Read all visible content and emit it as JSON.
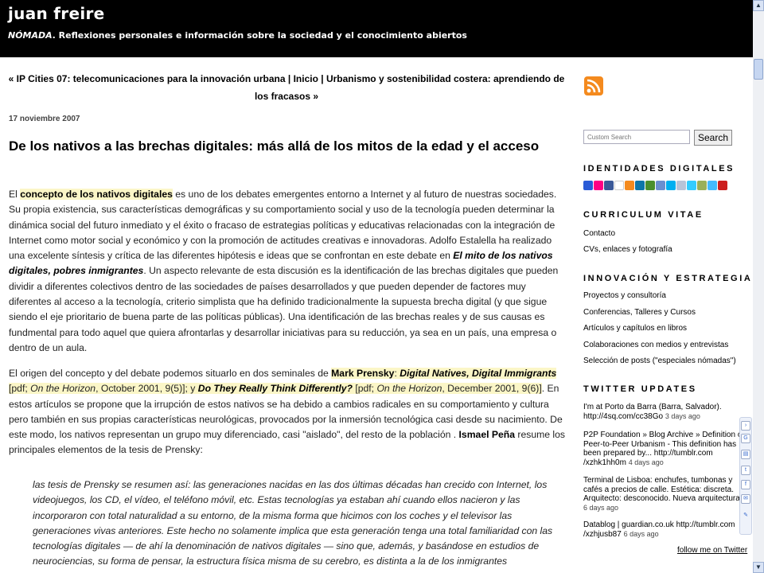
{
  "site": {
    "title": "juan freire",
    "tagline_prefix": "NÓMADA",
    "tagline_rest": ". Reflexiones personales e información sobre la sociedad y el conocimiento abiertos"
  },
  "nav": {
    "prev_label": "« IP Cities 07: telecomunicaciones para la innovación urbana",
    "sep1": " | ",
    "home_label": "Inicio",
    "sep2": " | ",
    "next_label": "Urbanismo y sostenibilidad costera: aprendiendo de los fracasos »"
  },
  "post": {
    "date": "17 noviembre 2007",
    "title": "De los nativos a las brechas digitales: más allá de los mitos de la edad y el acceso",
    "p1": {
      "t1": "El ",
      "link1": "concepto de los nativos digitales",
      "t2": " es uno de los debates emergentes entorno a Internet y al futuro de nuestras sociedades. Su propia existencia, sus características demográficas y su comportamiento social y uso de la tecnología pueden determinar la dinámica social del futuro inmediato y el éxito o fracaso de estrategias políticas y educativas relacionadas con la integración de Internet como motor social y económico y con la promoción de actitudes creativas e innovadoras. Adolfo Estalella ha realizado una excelente síntesis y crítica de las diferentes hipótesis e ideas que se confrontan en este debate en ",
      "link2": "El mito de los nativos digitales, pobres inmigrantes",
      "t3": ". Un aspecto relevante de esta discusión es la identificación de las brechas digitales que pueden dividir a diferentes colectivos dentro de las sociedades de países desarrollados y que pueden depender de factores muy diferentes al acceso a la tecnología, criterio simplista que ha definido tradicionalmente la supuesta brecha digital (y que sigue siendo el eje prioritario de buena parte de las políticas públicas). Una identificación de las brechas reales y de sus causas es fundmental para todo aquel que quiera afrontarlas y desarrollar iniciativas para su reducción, ya sea en un país, una empresa o dentro de un aula."
    },
    "p2": {
      "t1": "El origen del concepto y del debate podemos situarlo en dos seminales de ",
      "author": "Mark Prensky",
      "t2": ": ",
      "work1": "Digital Natives, Digital Immigrants",
      "t3": " [pdf; ",
      "journal1": "On the Horizon",
      "t4": ", October 2001, 9(5)]; y ",
      "work2": "Do They Really Think Differently?",
      "t5": " [pdf; ",
      "journal2": "On the Horizon",
      "t6": ", December 2001, 9(6)]",
      "t7": ". En estos artículos se propone que la irrupción de estos nativos se ha debido a cambios radicales en su comportamiento y cultura pero también en sus propias características neurológicas, provocados por la inmersión tecnológica casi desde su nacimiento. De este modo, los nativos representan un grupo muy diferenciado, casi \"aislado\", del resto de la población . ",
      "person": "Ismael Peña",
      "t8": " resume los principales elementos de la tesis de Prensky:"
    },
    "quote": "las tesis de Prensky se resumen así: las generaciones nacidas en las dos últimas décadas han crecido con Internet, los videojuegos, los CD, el vídeo, el teléfono móvil, etc. Estas tecnologías ya estaban ahí cuando ellos nacieron y las incorporaron con total naturalidad a su entorno, de la misma forma que hicimos con los coches y el televisor las generaciones vivas anteriores. Este hecho no solamente implica que esta generación tenga una total familiaridad con las tecnologías digitales — de ahí la denominación de nativos digitales — sino que, además, y basándose en estudios de neurociencias, su forma de pensar, la estructura física misma de su cerebro, es distinta a la de los inmigrantes"
  },
  "sidebar": {
    "search_placeholder": "Custom Search",
    "search_button": "Search",
    "identidades_heading": "IDENTIDADES DIGITALES",
    "social_icons": [
      "delicious-icon",
      "flickr-icon",
      "facebook-icon",
      "flickr-dots-icon",
      "rss-icon",
      "linkedin-icon",
      "google-icon",
      "friendfeed-icon",
      "skype-icon",
      "plurk-icon",
      "twitter-icon",
      "mail-icon",
      "vimeo-icon",
      "youtube-icon"
    ],
    "cv_heading": "CURRICULUM VITAE",
    "cv_links": [
      "Contacto",
      "CVs, enlaces y fotografía"
    ],
    "innovacion_heading": "INNOVACIÓN Y ESTRATEGIA",
    "innovacion_links": [
      "Proyectos y consultoría",
      "Conferencias, Talleres y Cursos",
      "Artículos y capítulos en libros",
      "Colaboraciones con medios y entrevistas",
      "Selección de posts (\"especiales nómadas\")"
    ],
    "twitter_heading": "TWITTER UPDATES",
    "tweets": [
      {
        "text": "I'm at Porto da Barra (Barra, Salvador). http://4sq.com/cc38Go",
        "time": "3 days ago"
      },
      {
        "text": "P2P Foundation » Blog Archive » Definition of Peer-to-Peer Urbanism - This definition has been prepared by... http://tumblr.com /xzhk1hh0m",
        "time": "4 days ago"
      },
      {
        "text": "Terminal de Lisboa: enchufes, tumbonas y cafés a precios de calle. Estética: discreta. Arquitecto: desconocido. Nueva arquitectura?",
        "time": "6 days ago"
      },
      {
        "text": "Datablog | guardian.co.uk http://tumblr.com /xzhjusb87",
        "time": "6 days ago"
      }
    ],
    "follow_label": "follow me on Twitter"
  },
  "colors": {
    "header_bg": "#000000",
    "highlight": "#fbf6c7",
    "rss_orange": "#f48a1e"
  }
}
